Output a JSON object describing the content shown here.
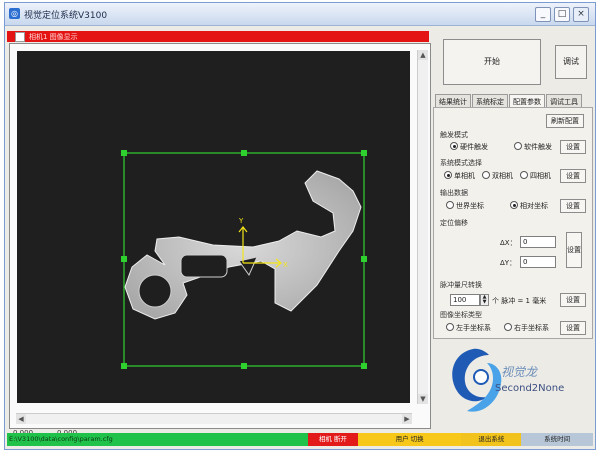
{
  "window": {
    "title": "视觉定位系统V3100",
    "controls": {
      "minimize": "_",
      "maximize": "□",
      "close": "×"
    }
  },
  "strip": {
    "text": "相机1 图像显示"
  },
  "viewer": {
    "axis_y_label": "Y",
    "axis_x_label": "X",
    "coord_x": "0.000",
    "coord_y": "0.000"
  },
  "buttons": {
    "start": "开始",
    "test": "调试"
  },
  "tabs": [
    {
      "label": "结果统计",
      "active": false
    },
    {
      "label": "系统标定",
      "active": false
    },
    {
      "label": "配置参数",
      "active": true
    },
    {
      "label": "调试工具",
      "active": false
    }
  ],
  "panel": {
    "refresh_button": "刷新配置",
    "trigger": {
      "title": "触发模式",
      "options": [
        "硬件触发",
        "软件触发"
      ],
      "selected": 0,
      "set": "设置"
    },
    "mode": {
      "title": "系统模式选择",
      "options": [
        "单相机",
        "双相机",
        "四相机"
      ],
      "selected": 0,
      "set": "设置"
    },
    "output": {
      "title": "输出数据",
      "options": [
        "世界坐标",
        "相对坐标"
      ],
      "selected": 1,
      "set": "设置"
    },
    "offset": {
      "title": "定位偏移",
      "dx_label": "ΔX：",
      "dx_value": "0",
      "dy_label": "ΔY：",
      "dy_value": "0",
      "set": "设置"
    },
    "pulse": {
      "title": "脉冲量尺转换",
      "value": "100",
      "unit_text": "个 脉冲 = 1 毫米",
      "set": "设置"
    },
    "coord_type": {
      "title": "图像坐标类型",
      "options": [
        "左手坐标系",
        "右手坐标系"
      ],
      "selected": -1,
      "set": "设置"
    }
  },
  "logo": {
    "cn": "视觉龙",
    "en": "Second2None"
  },
  "statusbar": {
    "path": "E:\\V3100\\data\\config\\param.cfg",
    "camera": "相机 断开",
    "user": "用户 切换",
    "exit": "退出系统",
    "time": "系统时间"
  },
  "colors": {
    "statusbar_path": "#21c24a",
    "statusbar_camera": "#e31a1a",
    "statusbar_user": "#f7c81a",
    "statusbar_exit": "#f2c31c",
    "statusbar_time": "#b7c7d8",
    "roi": "#2fd12f",
    "axis": "#f4e51a"
  }
}
